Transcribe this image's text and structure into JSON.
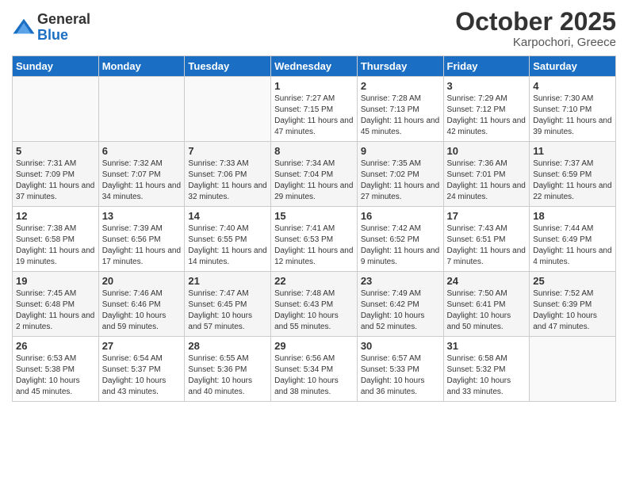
{
  "logo": {
    "general": "General",
    "blue": "Blue"
  },
  "header": {
    "month": "October 2025",
    "location": "Karpochori, Greece"
  },
  "days_of_week": [
    "Sunday",
    "Monday",
    "Tuesday",
    "Wednesday",
    "Thursday",
    "Friday",
    "Saturday"
  ],
  "weeks": [
    [
      {
        "day": "",
        "info": ""
      },
      {
        "day": "",
        "info": ""
      },
      {
        "day": "",
        "info": ""
      },
      {
        "day": "1",
        "sunrise": "7:27 AM",
        "sunset": "7:15 PM",
        "daylight": "11 hours and 47 minutes."
      },
      {
        "day": "2",
        "sunrise": "7:28 AM",
        "sunset": "7:13 PM",
        "daylight": "11 hours and 45 minutes."
      },
      {
        "day": "3",
        "sunrise": "7:29 AM",
        "sunset": "7:12 PM",
        "daylight": "11 hours and 42 minutes."
      },
      {
        "day": "4",
        "sunrise": "7:30 AM",
        "sunset": "7:10 PM",
        "daylight": "11 hours and 39 minutes."
      }
    ],
    [
      {
        "day": "5",
        "sunrise": "7:31 AM",
        "sunset": "7:09 PM",
        "daylight": "11 hours and 37 minutes."
      },
      {
        "day": "6",
        "sunrise": "7:32 AM",
        "sunset": "7:07 PM",
        "daylight": "11 hours and 34 minutes."
      },
      {
        "day": "7",
        "sunrise": "7:33 AM",
        "sunset": "7:06 PM",
        "daylight": "11 hours and 32 minutes."
      },
      {
        "day": "8",
        "sunrise": "7:34 AM",
        "sunset": "7:04 PM",
        "daylight": "11 hours and 29 minutes."
      },
      {
        "day": "9",
        "sunrise": "7:35 AM",
        "sunset": "7:02 PM",
        "daylight": "11 hours and 27 minutes."
      },
      {
        "day": "10",
        "sunrise": "7:36 AM",
        "sunset": "7:01 PM",
        "daylight": "11 hours and 24 minutes."
      },
      {
        "day": "11",
        "sunrise": "7:37 AM",
        "sunset": "6:59 PM",
        "daylight": "11 hours and 22 minutes."
      }
    ],
    [
      {
        "day": "12",
        "sunrise": "7:38 AM",
        "sunset": "6:58 PM",
        "daylight": "11 hours and 19 minutes."
      },
      {
        "day": "13",
        "sunrise": "7:39 AM",
        "sunset": "6:56 PM",
        "daylight": "11 hours and 17 minutes."
      },
      {
        "day": "14",
        "sunrise": "7:40 AM",
        "sunset": "6:55 PM",
        "daylight": "11 hours and 14 minutes."
      },
      {
        "day": "15",
        "sunrise": "7:41 AM",
        "sunset": "6:53 PM",
        "daylight": "11 hours and 12 minutes."
      },
      {
        "day": "16",
        "sunrise": "7:42 AM",
        "sunset": "6:52 PM",
        "daylight": "11 hours and 9 minutes."
      },
      {
        "day": "17",
        "sunrise": "7:43 AM",
        "sunset": "6:51 PM",
        "daylight": "11 hours and 7 minutes."
      },
      {
        "day": "18",
        "sunrise": "7:44 AM",
        "sunset": "6:49 PM",
        "daylight": "11 hours and 4 minutes."
      }
    ],
    [
      {
        "day": "19",
        "sunrise": "7:45 AM",
        "sunset": "6:48 PM",
        "daylight": "11 hours and 2 minutes."
      },
      {
        "day": "20",
        "sunrise": "7:46 AM",
        "sunset": "6:46 PM",
        "daylight": "10 hours and 59 minutes."
      },
      {
        "day": "21",
        "sunrise": "7:47 AM",
        "sunset": "6:45 PM",
        "daylight": "10 hours and 57 minutes."
      },
      {
        "day": "22",
        "sunrise": "7:48 AM",
        "sunset": "6:43 PM",
        "daylight": "10 hours and 55 minutes."
      },
      {
        "day": "23",
        "sunrise": "7:49 AM",
        "sunset": "6:42 PM",
        "daylight": "10 hours and 52 minutes."
      },
      {
        "day": "24",
        "sunrise": "7:50 AM",
        "sunset": "6:41 PM",
        "daylight": "10 hours and 50 minutes."
      },
      {
        "day": "25",
        "sunrise": "7:52 AM",
        "sunset": "6:39 PM",
        "daylight": "10 hours and 47 minutes."
      }
    ],
    [
      {
        "day": "26",
        "sunrise": "6:53 AM",
        "sunset": "5:38 PM",
        "daylight": "10 hours and 45 minutes."
      },
      {
        "day": "27",
        "sunrise": "6:54 AM",
        "sunset": "5:37 PM",
        "daylight": "10 hours and 43 minutes."
      },
      {
        "day": "28",
        "sunrise": "6:55 AM",
        "sunset": "5:36 PM",
        "daylight": "10 hours and 40 minutes."
      },
      {
        "day": "29",
        "sunrise": "6:56 AM",
        "sunset": "5:34 PM",
        "daylight": "10 hours and 38 minutes."
      },
      {
        "day": "30",
        "sunrise": "6:57 AM",
        "sunset": "5:33 PM",
        "daylight": "10 hours and 36 minutes."
      },
      {
        "day": "31",
        "sunrise": "6:58 AM",
        "sunset": "5:32 PM",
        "daylight": "10 hours and 33 minutes."
      },
      {
        "day": "",
        "info": ""
      }
    ]
  ],
  "labels": {
    "sunrise": "Sunrise:",
    "sunset": "Sunset:",
    "daylight": "Daylight:"
  }
}
